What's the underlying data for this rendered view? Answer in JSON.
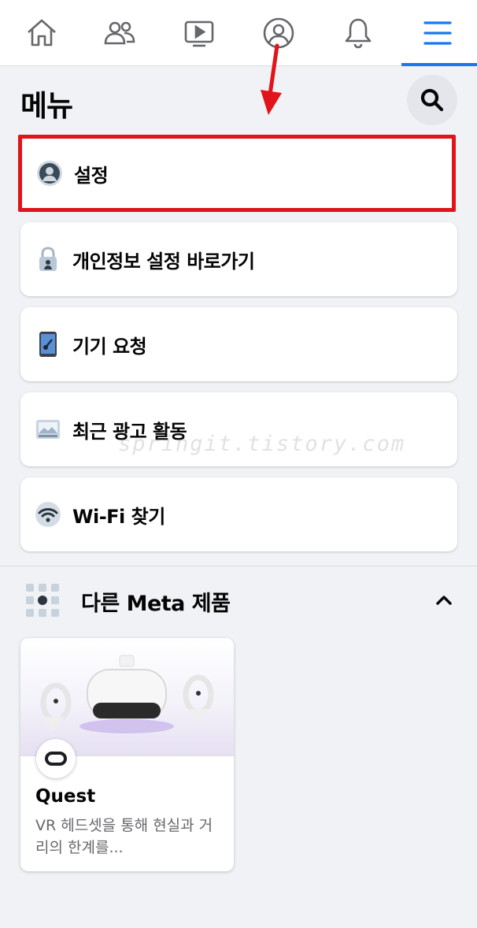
{
  "nav": {
    "items": [
      {
        "icon": "home-icon"
      },
      {
        "icon": "friends-icon"
      },
      {
        "icon": "watch-icon"
      },
      {
        "icon": "profile-icon"
      },
      {
        "icon": "bell-icon"
      },
      {
        "icon": "menu-icon",
        "active": true
      }
    ],
    "active_color": "#1877f2"
  },
  "header": {
    "title": "메뉴",
    "search_icon": "search-icon"
  },
  "menu_items": [
    {
      "label": "설정",
      "icon": "settings-person-icon",
      "highlighted": true
    },
    {
      "label": "개인정보 설정 바로가기",
      "icon": "lock-icon"
    },
    {
      "label": "기기 요청",
      "icon": "phone-key-icon"
    },
    {
      "label": "최근 광고 활동",
      "icon": "ad-image-icon"
    },
    {
      "label": "Wi-Fi 찾기",
      "icon": "wifi-icon"
    }
  ],
  "more_products": {
    "title": "다른 Meta 제품",
    "icon": "apps-grid-icon",
    "chevron": "chevron-up-icon",
    "products": [
      {
        "name": "Quest",
        "description": "VR 헤드셋을 통해 현실과 거리의 한계를...",
        "badge_icon": "quest-logo-icon"
      }
    ]
  },
  "annotation": {
    "highlight_color": "#e0141a"
  },
  "watermark": "springit.tistory.com"
}
